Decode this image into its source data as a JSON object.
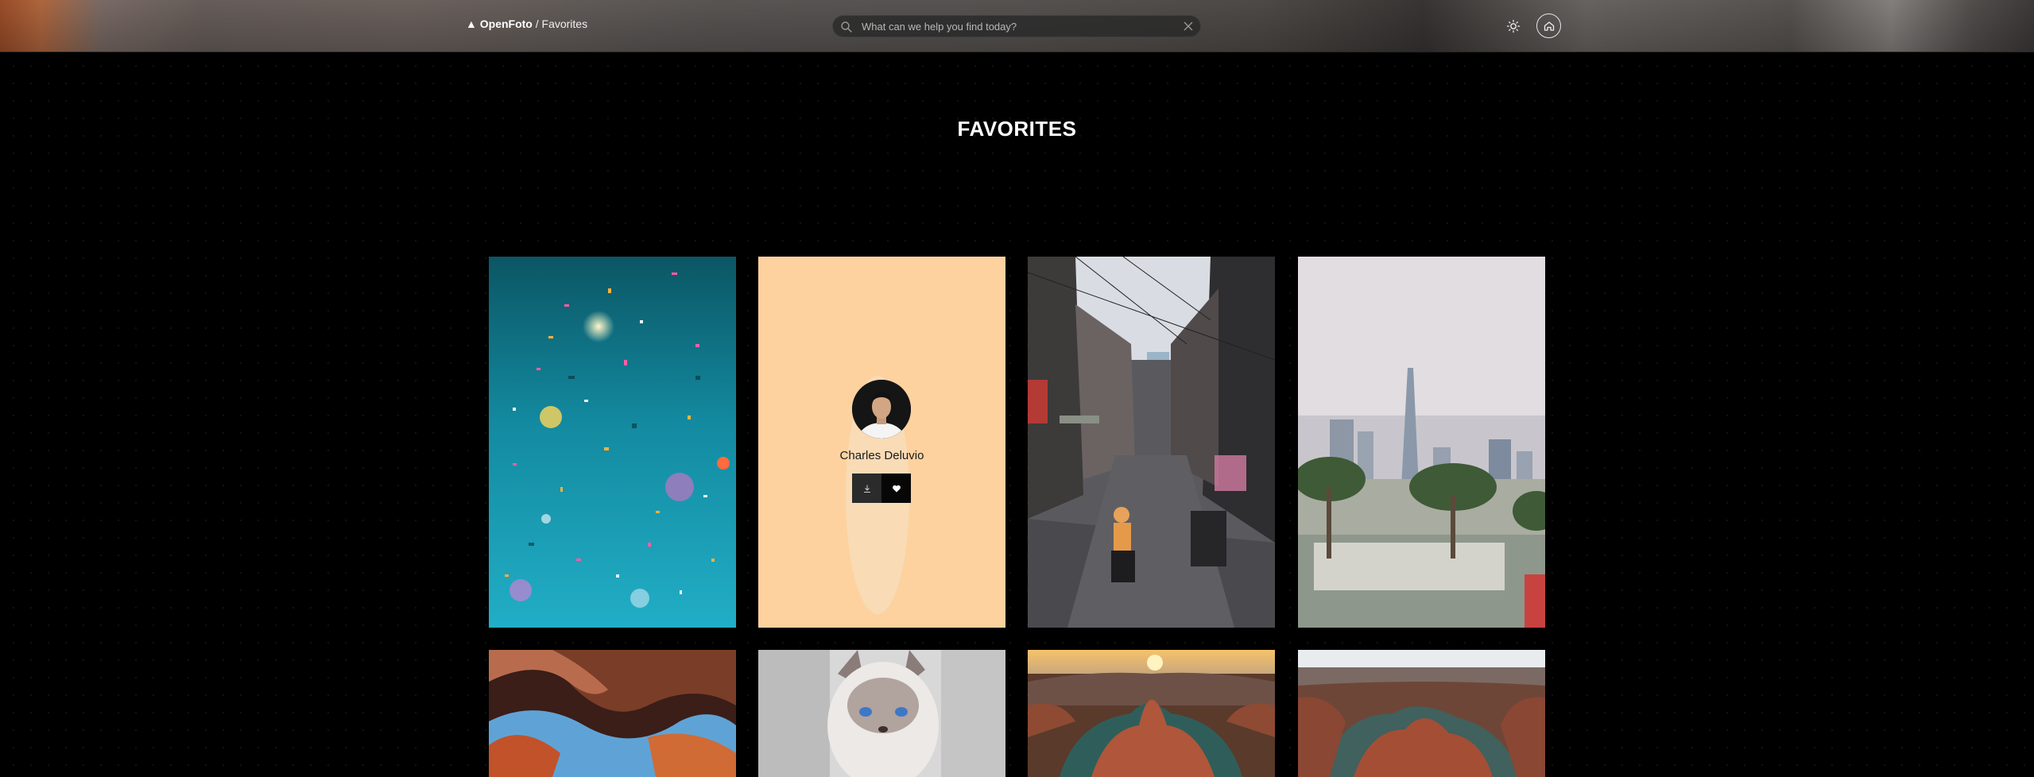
{
  "header": {
    "brand_logo": "▲ OpenFoto",
    "brand_separator": " / ",
    "breadcrumb": "Favorites",
    "search_placeholder": "What can we help you find today?",
    "icons": [
      "search-icon",
      "close-icon",
      "sun-icon",
      "home-icon"
    ]
  },
  "page": {
    "title": "FAVORITES"
  },
  "gallery": {
    "highlighted_card": {
      "author_name": "Charles Deluvio",
      "icons": [
        "avatar",
        "download-icon",
        "heart-icon"
      ]
    },
    "photos": [
      {
        "subject": "confetti"
      },
      {
        "subject": "portrait-author-card"
      },
      {
        "subject": "street-market"
      },
      {
        "subject": "city-skyline"
      },
      {
        "subject": "canyon-rock"
      },
      {
        "subject": "cat"
      },
      {
        "subject": "horseshoe-bend-sunset"
      },
      {
        "subject": "horseshoe-bend"
      }
    ]
  },
  "colors": {
    "background": "#000000",
    "highlight_card": "#fdd29f",
    "text": "#ffffff"
  }
}
